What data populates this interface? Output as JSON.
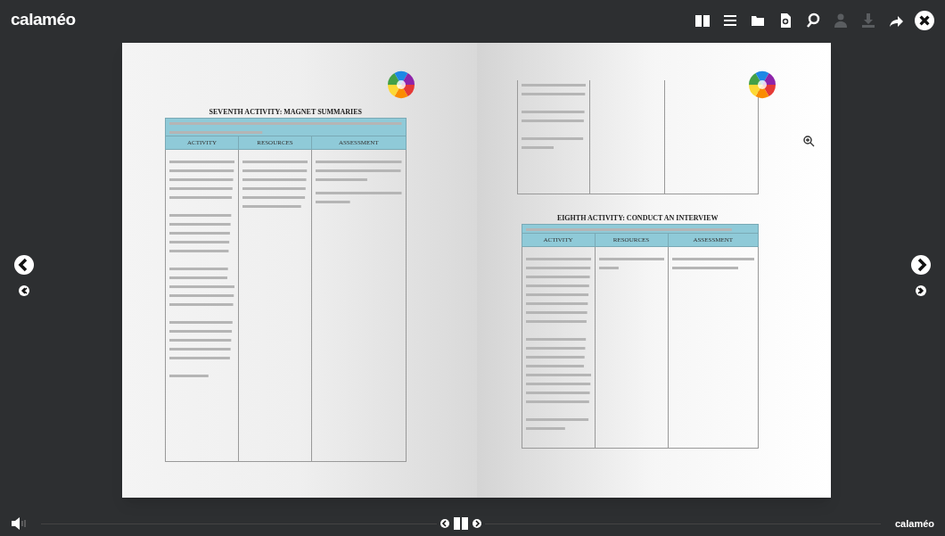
{
  "header": {
    "logo": "calaméo"
  },
  "toolbar": [
    {
      "kind": "book",
      "disabled": false
    },
    {
      "kind": "list",
      "disabled": false
    },
    {
      "kind": "folder",
      "disabled": false
    },
    {
      "kind": "document",
      "disabled": false
    },
    {
      "kind": "search",
      "disabled": false
    },
    {
      "kind": "person",
      "disabled": true
    },
    {
      "kind": "download",
      "disabled": true
    },
    {
      "kind": "share",
      "disabled": false
    },
    {
      "kind": "close",
      "disabled": false
    }
  ],
  "pages": [
    {
      "title": "SEVENTH ACTIVITY: MAGNET SUMMARIES",
      "columns": [
        "ACTIVITY",
        "RESOURCES",
        "ASSESSMENT"
      ]
    },
    {
      "title": "EIGHTH ACTIVITY: CONDUCT AN INTERVIEW",
      "columns": [
        "ACTIVITY",
        "RESOURCES",
        "ASSESSMENT"
      ]
    }
  ],
  "footer": {
    "logo": "calaméo"
  }
}
